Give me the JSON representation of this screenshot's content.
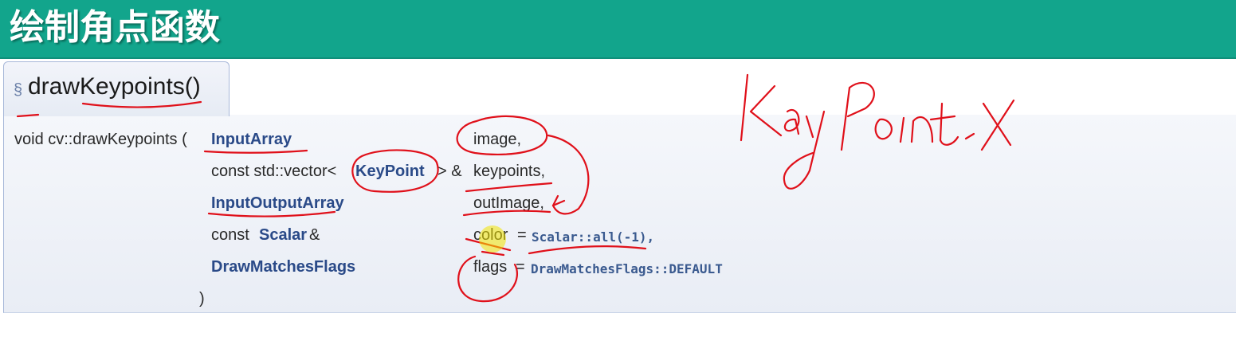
{
  "banner": {
    "title": "绘制角点函数"
  },
  "tab": {
    "section_mark": "§",
    "name": "drawKeypoints()"
  },
  "proto": {
    "prefix": "void cv::drawKeypoints (",
    "params": [
      {
        "type_pre": "",
        "type": "InputArray",
        "type_post": "",
        "name": "image,",
        "default": ""
      },
      {
        "type_pre": "const std::vector<",
        "type": "KeyPoint",
        "type_post": "> &",
        "name": "keypoints,",
        "default": ""
      },
      {
        "type_pre": "",
        "type": "InputOutputArray",
        "type_post": "",
        "name": "outImage,",
        "default": ""
      },
      {
        "type_pre": "const ",
        "type": "Scalar",
        "type_post": " &",
        "name": "color",
        "default": "Scalar::all(-1),"
      },
      {
        "type_pre": "",
        "type": "DrawMatchesFlags",
        "type_post": "",
        "name": "flags",
        "default": "DrawMatchesFlags::DEFAULT"
      }
    ],
    "close": ")",
    "equals": "="
  },
  "colors": {
    "banner": "#12a58c",
    "ink": "#e0101a",
    "link": "#2a4a88"
  }
}
